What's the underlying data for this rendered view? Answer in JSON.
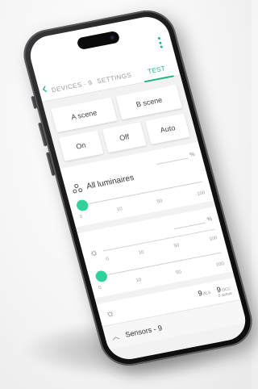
{
  "app": {
    "tabs": [
      {
        "label": "DEVICES - 9",
        "active": false
      },
      {
        "label": "SETTINGS",
        "active": false
      },
      {
        "label": "TEST",
        "active": true
      }
    ],
    "accent_color": "#17b57f",
    "knob_color": "#2fd29a"
  },
  "scenes": {
    "a_label": "A scene",
    "b_label": "B scene"
  },
  "modes": {
    "on_label": "On",
    "off_label": "Off",
    "auto_label": "Auto"
  },
  "luminaires": {
    "percent_symbol": "%",
    "label": "All luminaires",
    "icon": "luminaires-group-icon",
    "slider_value": 0,
    "ticks": [
      "0",
      "10",
      "50",
      "100"
    ]
  },
  "light_sensor": {
    "icon": "sun-icon",
    "percent_symbol": "%",
    "top_ticks": [
      "0",
      "10",
      "50",
      "100"
    ],
    "slider_value": 0,
    "bottom_ticks": [
      "0",
      "10",
      "50",
      "100"
    ]
  },
  "sensor_summary": {
    "icon": "sun-icon",
    "als_count": "9",
    "als_label": "ALS",
    "occ_count": "9",
    "occ_label": "OCC",
    "occ_sub": "0 active"
  },
  "sensors_section": {
    "label": "Sensors - 9",
    "icon": "chevron-up-icon"
  }
}
